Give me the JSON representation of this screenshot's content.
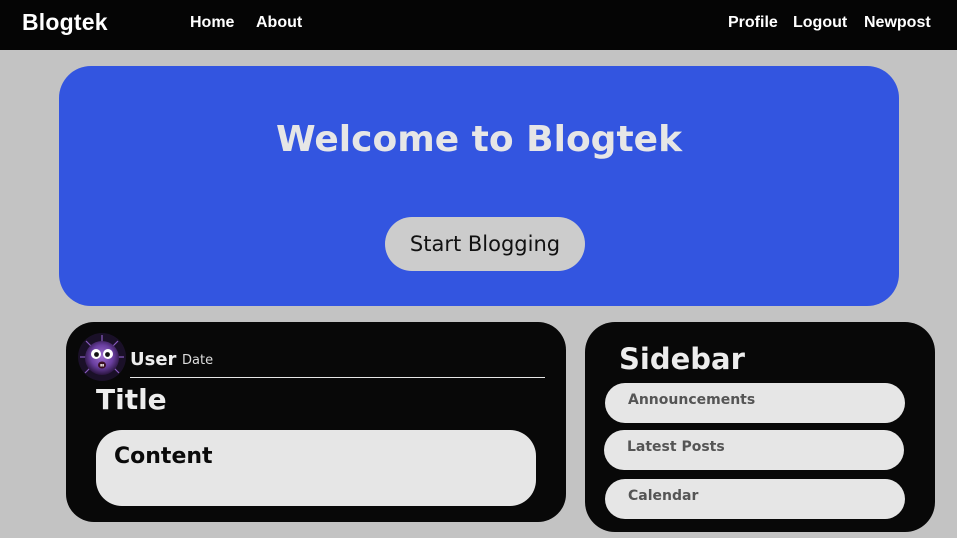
{
  "navbar": {
    "brand": "Blogtek",
    "left_links": [
      {
        "label": "Home"
      },
      {
        "label": "About"
      }
    ],
    "right_links": [
      {
        "label": "Profile"
      },
      {
        "label": "Logout"
      },
      {
        "label": "Newpost"
      }
    ]
  },
  "hero": {
    "title": "Welcome to Blogtek",
    "button_label": "Start Blogging"
  },
  "post": {
    "avatar_icon": "purple-monster-avatar-icon",
    "user": "User",
    "date": "Date",
    "title": "Title",
    "content": "Content"
  },
  "sidebar": {
    "title": "Sidebar",
    "items": [
      {
        "label": "Announcements"
      },
      {
        "label": "Latest Posts"
      },
      {
        "label": "Calendar"
      }
    ]
  },
  "colors": {
    "page_background": "#c3c3c3",
    "navbar_background": "#050505",
    "hero_background": "#3355e0",
    "card_background": "#080808",
    "pill_background": "#e6e6e6"
  }
}
